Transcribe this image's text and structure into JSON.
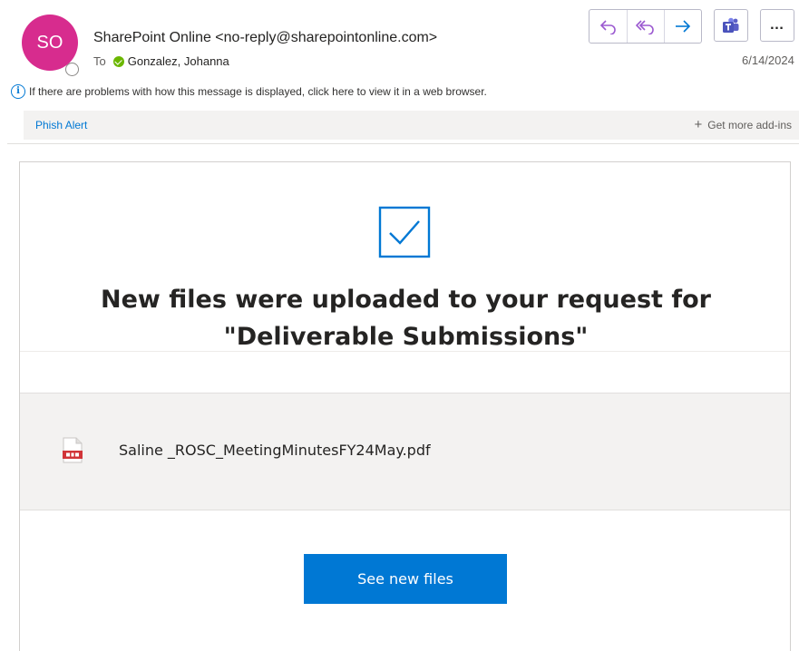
{
  "message": {
    "avatar_initials": "SO",
    "sender": "SharePoint Online <no-reply@sharepointonline.com>",
    "to_label": "To",
    "recipient": "Gonzalez, Johanna",
    "date": "6/14/2024",
    "info_text": "If there are problems with how this message is displayed, click here to view it in a web browser."
  },
  "toolbar": {
    "reply_icon": "reply-icon",
    "reply_all_icon": "reply-all-icon",
    "forward_icon": "forward-icon",
    "teams_icon": "teams-icon",
    "more_label": "…"
  },
  "addins": {
    "phish_alert": "Phish Alert",
    "get_more": "Get more add-ins"
  },
  "email_body": {
    "headline_line1": "New files were uploaded to your request for",
    "headline_line2": "\"Deliverable Submissions\"",
    "file_name": "Saline _ROSC_MeetingMinutesFY24May.pdf",
    "button_label": "See new files"
  },
  "colors": {
    "avatar": "#d72c8e",
    "accent": "#0078d4",
    "toolbar_icons": "#9b59d0"
  }
}
